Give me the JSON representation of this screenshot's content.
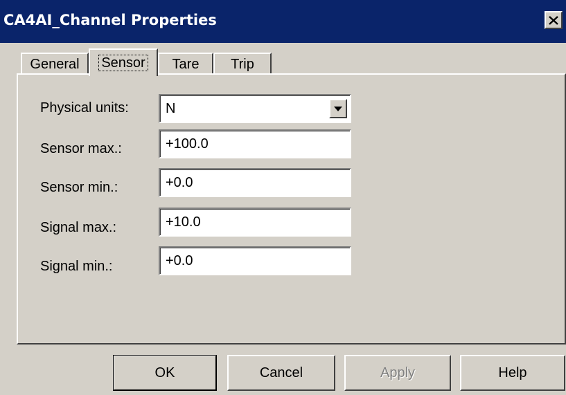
{
  "window": {
    "title": "CA4AI_Channel Properties",
    "close_icon": "close-icon"
  },
  "tabs": [
    {
      "label": "General",
      "active": false
    },
    {
      "label": "Sensor",
      "active": true
    },
    {
      "label": "Tare",
      "active": false
    },
    {
      "label": "Trip",
      "active": false
    }
  ],
  "sensor": {
    "physical_units_label": "Physical units:",
    "physical_units_value": "N",
    "sensor_max_label": "Sensor max.:",
    "sensor_max_value": "+100.0",
    "sensor_min_label": "Sensor min.:",
    "sensor_min_value": "+0.0",
    "signal_max_label": "Signal max.:",
    "signal_max_value": "+10.0",
    "signal_min_label": "Signal min.:",
    "signal_min_value": "+0.0"
  },
  "buttons": {
    "ok": "OK",
    "cancel": "Cancel",
    "apply": "Apply",
    "help": "Help"
  },
  "colors": {
    "titlebar": "#0a246a",
    "face": "#d4d0c8",
    "disabled_text": "#808080"
  }
}
